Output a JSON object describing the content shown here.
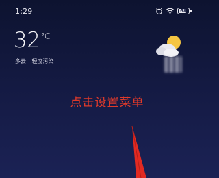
{
  "status_bar": {
    "time": "1:29",
    "icons": [
      "alarm-icon",
      "wifi-icon",
      "battery-icon"
    ],
    "battery_level": "68"
  },
  "weather": {
    "temperature": "32",
    "unit": "°C",
    "condition": "多云",
    "air_quality": "轻度污染",
    "icon": "partly-cloudy-icon"
  },
  "annotation": {
    "text": "点击设置菜单",
    "color": "#e03a2a",
    "arrow": "red-arrow-pointing-down"
  },
  "colors": {
    "background_top": "#0d1330",
    "background_bottom": "#1b2255",
    "sun": "#f5c542"
  }
}
